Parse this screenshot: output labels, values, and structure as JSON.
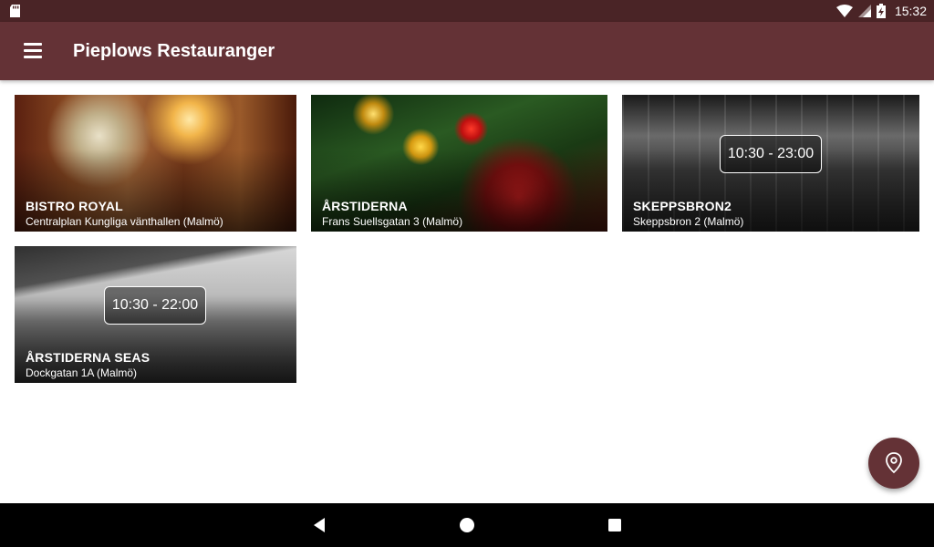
{
  "status_bar": {
    "time": "15:32",
    "icons": [
      "sd-card-icon",
      "wifi-icon",
      "cell-signal-icon",
      "battery-charging-icon"
    ]
  },
  "app_bar": {
    "title": "Pieplows Restauranger",
    "menu_icon": "hamburger-menu-icon",
    "background": "#643236"
  },
  "restaurants": [
    {
      "name": "BISTRO ROYAL",
      "address": "Centralplan Kungliga vänthallen (Malmö)",
      "hours": "",
      "image_tone": "warm"
    },
    {
      "name": "ÅRSTIDERNA",
      "address": "Frans Suellsgatan 3 (Malmö)",
      "hours": "",
      "image_tone": "festive"
    },
    {
      "name": "SKEPPSBRON2",
      "address": "Skeppsbron 2 (Malmö)",
      "hours": "10:30 - 23:00",
      "image_tone": "grayscale"
    },
    {
      "name": "ÅRSTIDERNA SEAS",
      "address": "Dockgatan 1A (Malmö)",
      "hours": "10:30 - 22:00",
      "image_tone": "grayscale"
    }
  ],
  "fab": {
    "icon": "map-pin-icon",
    "color": "#643236"
  },
  "nav_bar": {
    "buttons": [
      "back-icon",
      "home-icon",
      "recents-icon"
    ]
  }
}
